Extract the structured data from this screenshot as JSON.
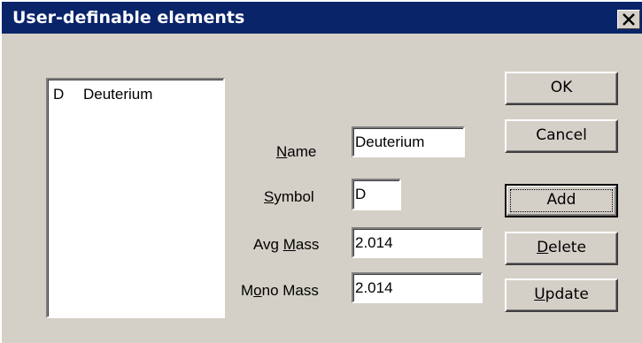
{
  "window": {
    "title": "User-definable elements"
  },
  "elements_list": {
    "items": [
      {
        "symbol": "D",
        "name": "Deuterium"
      }
    ]
  },
  "form": {
    "name_label_u": "N",
    "name_label_rest": "ame",
    "name_value": "Deuterium",
    "symbol_label_u": "S",
    "symbol_label_rest": "ymbol",
    "symbol_value": "D",
    "avg_label_pre": "Avg ",
    "avg_label_u": "M",
    "avg_label_rest": "ass",
    "avg_value": "2.014",
    "mono_label_pre": "M",
    "mono_label_u": "o",
    "mono_label_rest": "no Mass",
    "mono_value": "2.014"
  },
  "buttons": {
    "ok": "OK",
    "cancel": "Cancel",
    "add": "Add",
    "delete_u": "D",
    "delete_rest": "elete",
    "update_u": "U",
    "update_rest": "pdate"
  },
  "icons": {
    "close": "close-icon"
  },
  "colors": {
    "titlebar": "#0a246a",
    "face": "#d4d0c8"
  }
}
